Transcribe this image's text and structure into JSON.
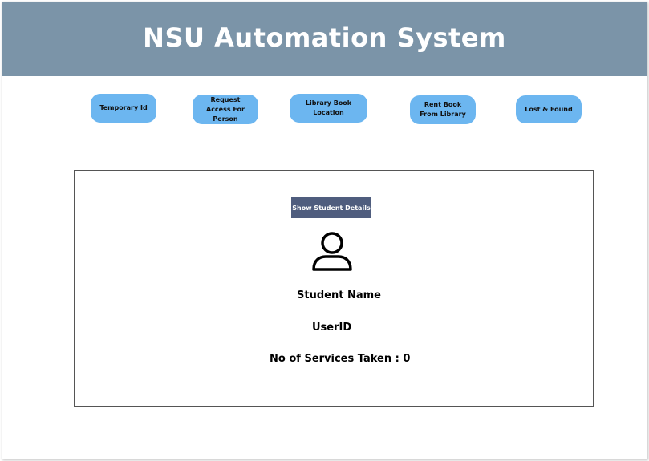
{
  "header": {
    "title": "NSU Automation System"
  },
  "nav": {
    "temporary_id": "Temporary Id",
    "request_access": "Request Access For Person",
    "library_book_location": "Library Book Location",
    "rent_book": "Rent Book From Library",
    "lost_and_found": "Lost & Found"
  },
  "panel": {
    "show_details_label": "Show Student Details",
    "avatar_icon": "user-icon",
    "student_name": "Student Name",
    "user_id": "UserID",
    "services_taken": "No of Services Taken : 0"
  },
  "colors": {
    "header_bg": "#7b94a8",
    "nav_button_bg": "#6cb6f0",
    "details_button_bg": "#4f5d7e"
  }
}
